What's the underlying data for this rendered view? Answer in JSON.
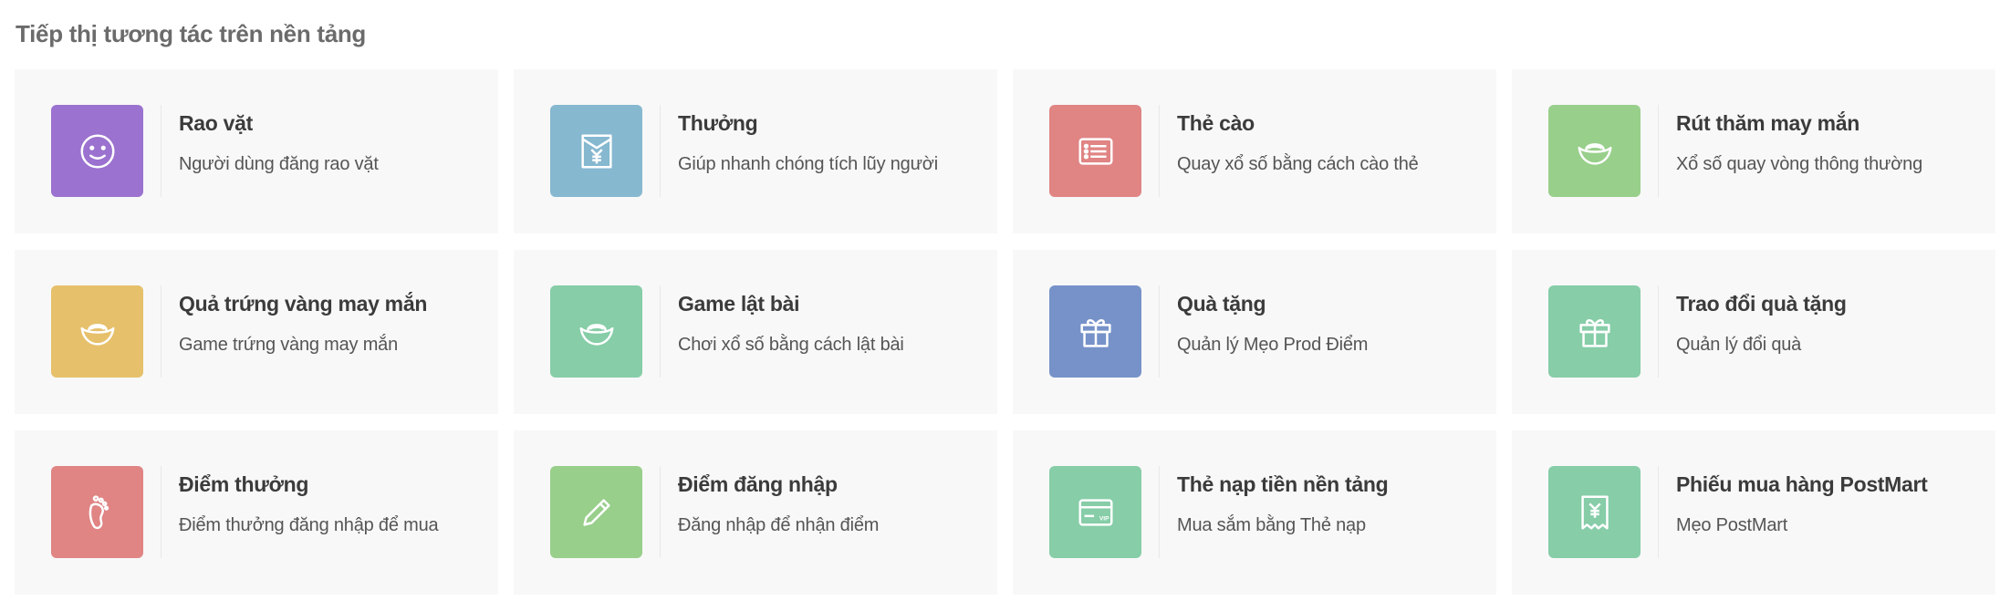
{
  "section": {
    "title": "Tiếp thị tương tác trên nền tảng"
  },
  "cards": [
    {
      "title": "Rao vặt",
      "desc": "Người dùng đăng rao vặt",
      "icon": "smiley-icon",
      "color": "#9b72cf"
    },
    {
      "title": "Thưởng",
      "desc": "Giúp nhanh chóng tích lũy người",
      "icon": "yen-envelope-icon",
      "color": "#86b8d0"
    },
    {
      "title": "Thẻ cào",
      "desc": "Quay xổ số bằng cách cào thẻ",
      "icon": "scratch-card-icon",
      "color": "#e08484"
    },
    {
      "title": "Rút thăm may mắn",
      "desc": "Xổ số quay vòng thông thường",
      "icon": "gold-ingot-icon",
      "color": "#98cf8b"
    },
    {
      "title": "Quả trứng vàng may mắn",
      "desc": "Game trứng vàng may mắn",
      "icon": "gold-ingot-icon",
      "color": "#e6c06b"
    },
    {
      "title": "Game lật bài",
      "desc": "Chơi xổ số bằng cách lật bài",
      "icon": "gold-ingot-icon",
      "color": "#86cda8"
    },
    {
      "title": "Quà tặng",
      "desc": "Quản lý Mẹo Prod Điểm",
      "icon": "gift-icon",
      "color": "#7692c9"
    },
    {
      "title": "Trao đổi quà tặng",
      "desc": "Quản lý đổi quà",
      "icon": "gift-icon",
      "color": "#86cda8"
    },
    {
      "title": "Điểm thưởng",
      "desc": "Điểm thưởng đăng nhập để mua",
      "icon": "footprint-icon",
      "color": "#e08484"
    },
    {
      "title": "Điểm đăng nhập",
      "desc": "Đăng nhập để nhận điểm",
      "icon": "pencil-icon",
      "color": "#98cf8b"
    },
    {
      "title": "Thẻ nạp tiền nền tảng",
      "desc": "Mua sắm bằng Thẻ nạp",
      "icon": "vip-card-icon",
      "color": "#86cda8"
    },
    {
      "title": "Phiếu mua hàng PostMart",
      "desc": "Mẹo PostMart",
      "icon": "yen-voucher-icon",
      "color": "#86cda8"
    }
  ]
}
